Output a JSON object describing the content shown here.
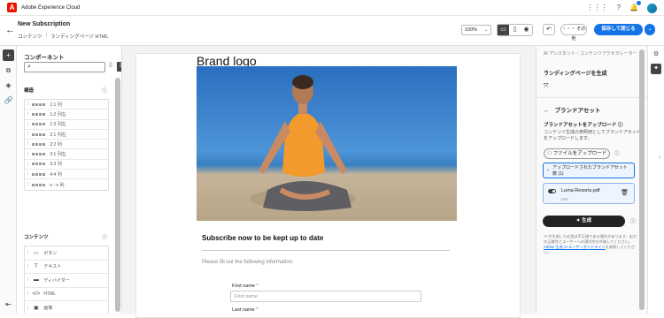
{
  "topbar": {
    "app_name": "Adobe Experience Cloud",
    "logo": "adobe-logo-icon"
  },
  "header": {
    "title": "New Subscription",
    "crumbs": [
      "コンテンツ",
      "ランディングページ HTML"
    ],
    "zoom": "100%",
    "more_label": "・・・ その他",
    "save_label": "保存して閉じる"
  },
  "components": {
    "title": "コンポーネント",
    "structure_label": "構造",
    "structure_rows": [
      "1:1 列",
      "1:2 列左",
      "1:3 列左",
      "2:1 列左",
      "2:2 列",
      "3:1 列左",
      "3:3 列",
      "4:4 列",
      "n : n 列"
    ],
    "content_label": "コンテンツ",
    "content_rows": [
      {
        "icon": "button-icon",
        "glyph": "▭",
        "label": "ボタン"
      },
      {
        "icon": "text-icon",
        "glyph": "T",
        "label": "テキスト"
      },
      {
        "icon": "divider-icon",
        "glyph": "▬",
        "label": "ディバイダー"
      },
      {
        "icon": "html-icon",
        "glyph": "</>",
        "label": "HTML"
      },
      {
        "icon": "image-icon",
        "glyph": "▣",
        "label": "画像"
      }
    ]
  },
  "canvas": {
    "brand_logo": "Brand logo",
    "subtitle": "Subscribe now to be kept up to date",
    "fill_text": "Please fill out the following information:",
    "first_name_label": "First name",
    "first_name_placeholder": "First name",
    "last_name_label": "Last name",
    "required_mark": "*"
  },
  "panel": {
    "assistant_label": "AI アシスタント・コンテンツアクセラレーター",
    "heading": "ランディングページを生成",
    "brand_assets": "ブランドアセット",
    "upload_heading": "ブランドアセットをアップロード",
    "upload_desc": "コンテンツ生成の参照用としてブランドアセットをアップロードします。",
    "upload_button": "ファイルをアップロード",
    "accordion_label": "アップロードされたブランドアセット数 (1)",
    "file_name": "Luma Resorts.pdf",
    "file_type": "PDF",
    "generate_label": "生成",
    "note": "AI が生成した応答は不正確である場合があります。出力の正確性とユーザーへの適切性を評価してください。",
    "note_link": "Adobe 生成 AI ユーザーガイドライン",
    "note_tail": "を参照してください。"
  },
  "colors": {
    "accent": "#1473e6",
    "adobe_red": "#eb1000"
  }
}
